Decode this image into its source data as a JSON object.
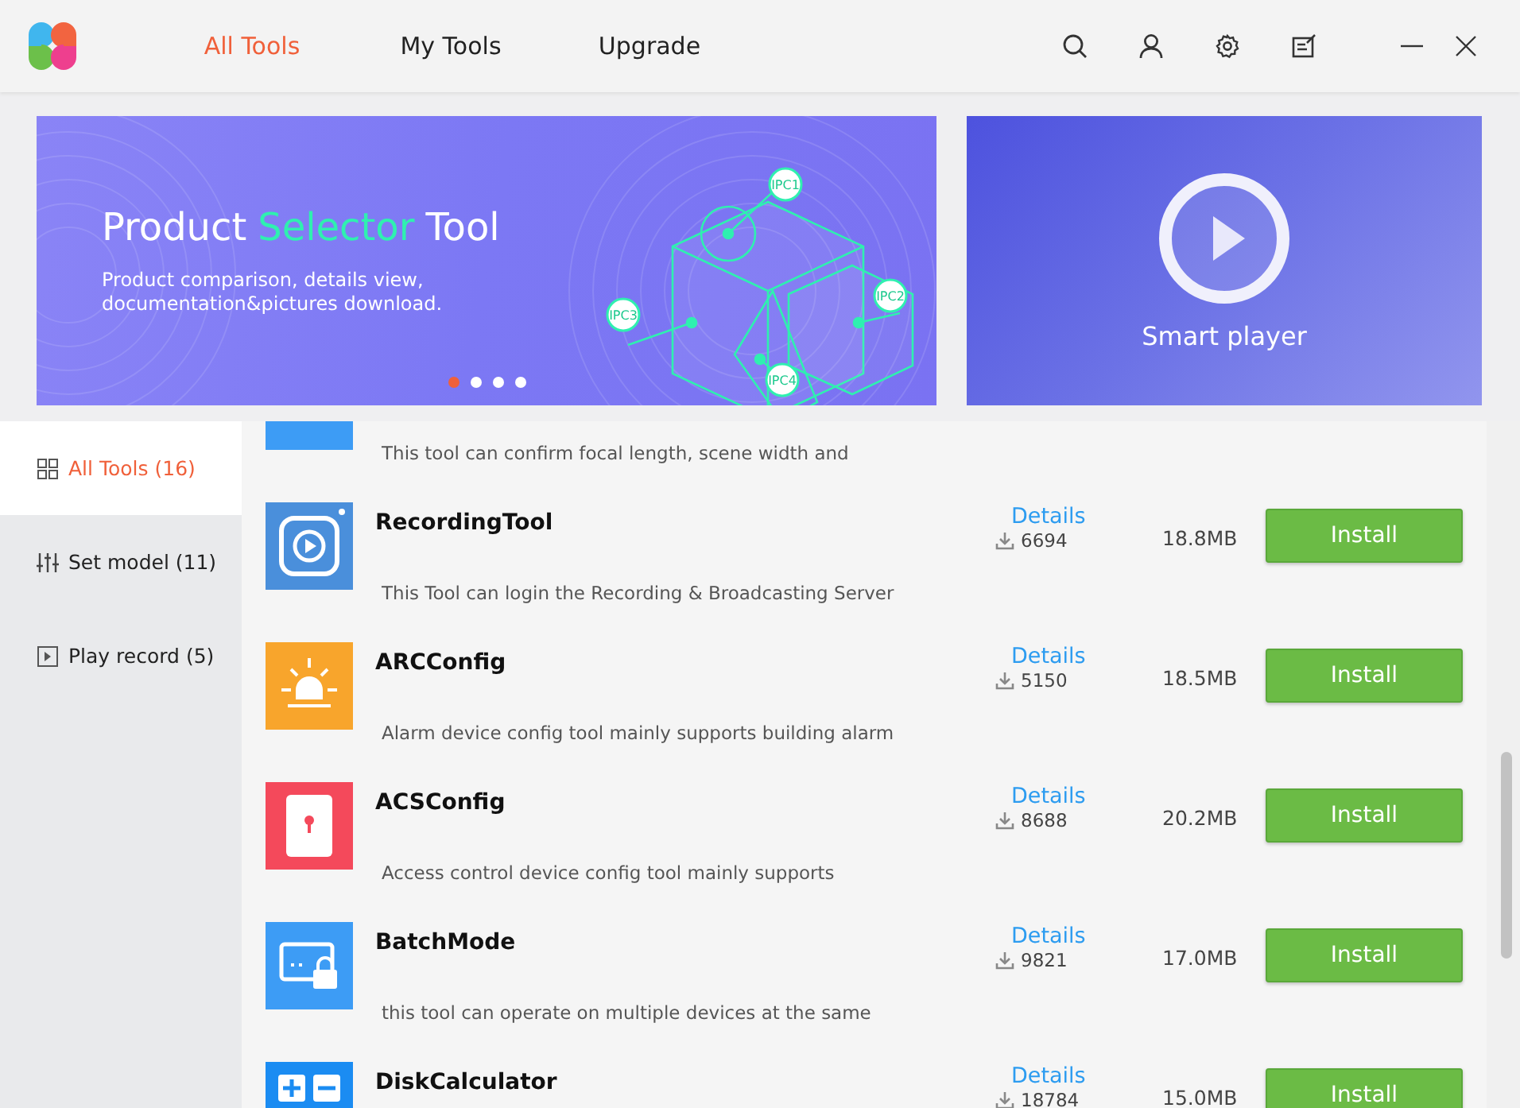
{
  "header": {
    "tabs": [
      {
        "label": "All Tools",
        "selected": true
      },
      {
        "label": "My Tools",
        "selected": false
      },
      {
        "label": "Upgrade",
        "selected": false
      }
    ],
    "tools": [
      {
        "kind": "search"
      },
      {
        "kind": "user"
      },
      {
        "kind": "settings"
      },
      {
        "kind": "note"
      }
    ],
    "window_controls": [
      {
        "kind": "minimize"
      },
      {
        "kind": "close"
      }
    ]
  },
  "banners": {
    "main": {
      "title_parts": [
        {
          "text": "Product",
          "highlight": false
        },
        {
          "text": "Selector",
          "highlight": true
        },
        {
          "text": "Tool",
          "highlight": false
        }
      ],
      "subtitle_lines": [
        "Product comparison, details view,",
        "documentation&pictures download."
      ],
      "diagram_labels": [
        "IPC1",
        "IPC2",
        "IPC3",
        "IPC4"
      ],
      "dots": [
        {
          "selected": true
        },
        {
          "selected": false
        },
        {
          "selected": false
        },
        {
          "selected": false
        }
      ]
    },
    "side": {
      "label": "Smart player"
    }
  },
  "sidebar": {
    "items": [
      {
        "kind": "grid",
        "label": "All Tools (16)",
        "selected": true
      },
      {
        "kind": "sliders",
        "label": "Set model (11)",
        "selected": false
      },
      {
        "kind": "play",
        "label": "Play record (5)",
        "selected": false
      }
    ]
  },
  "tools": [
    {
      "kind": "plain",
      "color": "#3d9cf5",
      "description": "This tool can confirm focal length, scene width and"
    },
    {
      "kind": "recorder",
      "color": "#4a8fdb",
      "name": "RecordingTool",
      "description": "This Tool can login the Recording & Broadcasting Server",
      "details": "Details",
      "downloads": "6694",
      "size": "18.8MB",
      "action": "Install"
    },
    {
      "kind": "alarm",
      "color": "#f8a52c",
      "name": "ARCConfig",
      "description": "Alarm device config tool mainly supports building alarm",
      "details": "Details",
      "downloads": "5150",
      "size": "18.5MB",
      "action": "Install"
    },
    {
      "kind": "door",
      "color": "#f4495b",
      "name": "ACSConfig",
      "description": "Access control device config tool mainly supports",
      "details": "Details",
      "downloads": "8688",
      "size": "20.2MB",
      "action": "Install"
    },
    {
      "kind": "batch",
      "color": "#3d9cf5",
      "name": "BatchMode",
      "description": "this tool can operate on multiple devices at the same",
      "details": "Details",
      "downloads": "9821",
      "size": "17.0MB",
      "action": "Install"
    },
    {
      "kind": "calculator",
      "color": "#1b8cf2",
      "name": "DiskCalculator",
      "details": "Details",
      "downloads": "18784",
      "size": "15.0MB",
      "action": "Install"
    }
  ]
}
